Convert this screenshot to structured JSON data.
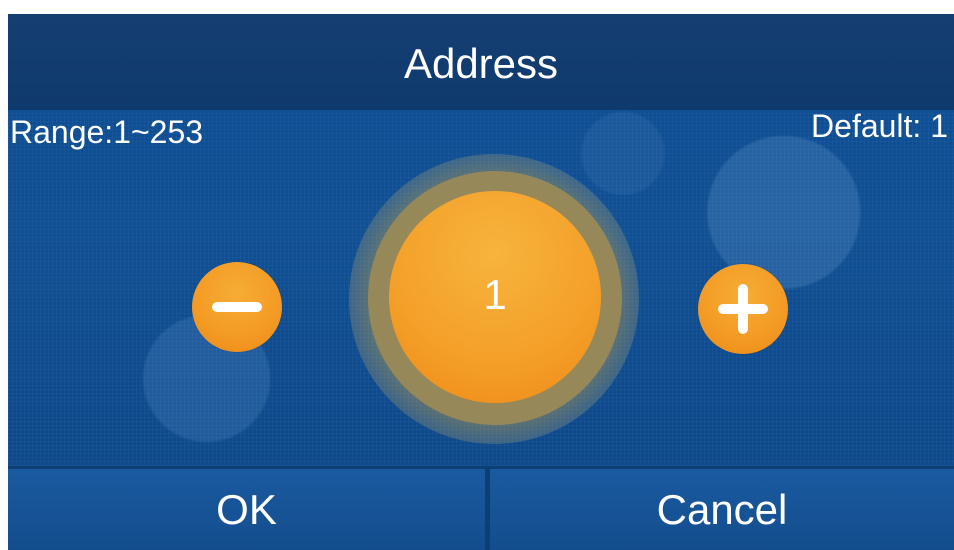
{
  "header": {
    "title": "Address"
  },
  "range": {
    "label": "Range:1~253"
  },
  "default": {
    "label": "Default: 1"
  },
  "value": {
    "current": "1"
  },
  "buttons": {
    "ok": "OK",
    "cancel": "Cancel",
    "decrease_icon": "minus-icon",
    "increase_icon": "plus-icon"
  },
  "colors": {
    "background": "#0f4f93",
    "title_bar": "#0f3a6d",
    "accent_orange": "#f4a12a",
    "text": "#ffffff"
  }
}
